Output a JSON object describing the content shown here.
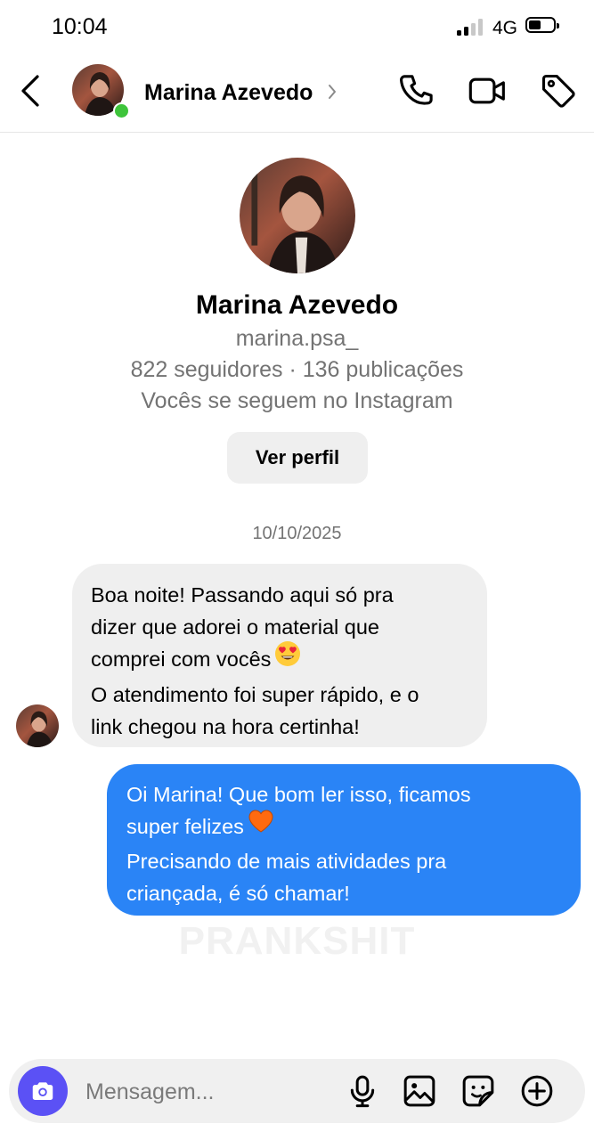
{
  "status_bar": {
    "time": "10:04",
    "network": "4G",
    "battery_level": 0.45
  },
  "header": {
    "contact_name": "Marina Azevedo",
    "online": true
  },
  "profile": {
    "name": "Marina Azevedo",
    "username": "marina.psa_",
    "stats": "822 seguidores · 136 publicações",
    "relation": "Vocês se seguem no Instagram",
    "view_profile_label": "Ver perfil"
  },
  "conversation": {
    "date": "10/10/2025",
    "incoming": {
      "line1": "Boa noite! Passando aqui só pra",
      "line2": "dizer que adorei o material que",
      "line3": "comprei com vocês",
      "line4": "O atendimento foi super rápido, e o",
      "line5": "link chegou na hora certinha!"
    },
    "outgoing": {
      "line1": "Oi Marina! Que bom ler isso, ficamos",
      "line2": "super felizes",
      "line3": "Precisando de mais atividades pra",
      "line4": "criançada, é só chamar!"
    }
  },
  "watermark": "PRANKSHIT",
  "composer": {
    "placeholder": "Mensagem..."
  },
  "colors": {
    "outgoing_bubble": "#2a84f6",
    "incoming_bubble": "#efefef",
    "camera_button": "#5b51f5",
    "online_dot": "#3ec43b"
  },
  "icons": [
    "back-chevron-icon",
    "phone-icon",
    "video-camera-icon",
    "tag-icon",
    "camera-icon",
    "microphone-icon",
    "gallery-icon",
    "sticker-icon",
    "plus-circle-icon",
    "heart-eyes-emoji",
    "orange-heart-emoji"
  ]
}
